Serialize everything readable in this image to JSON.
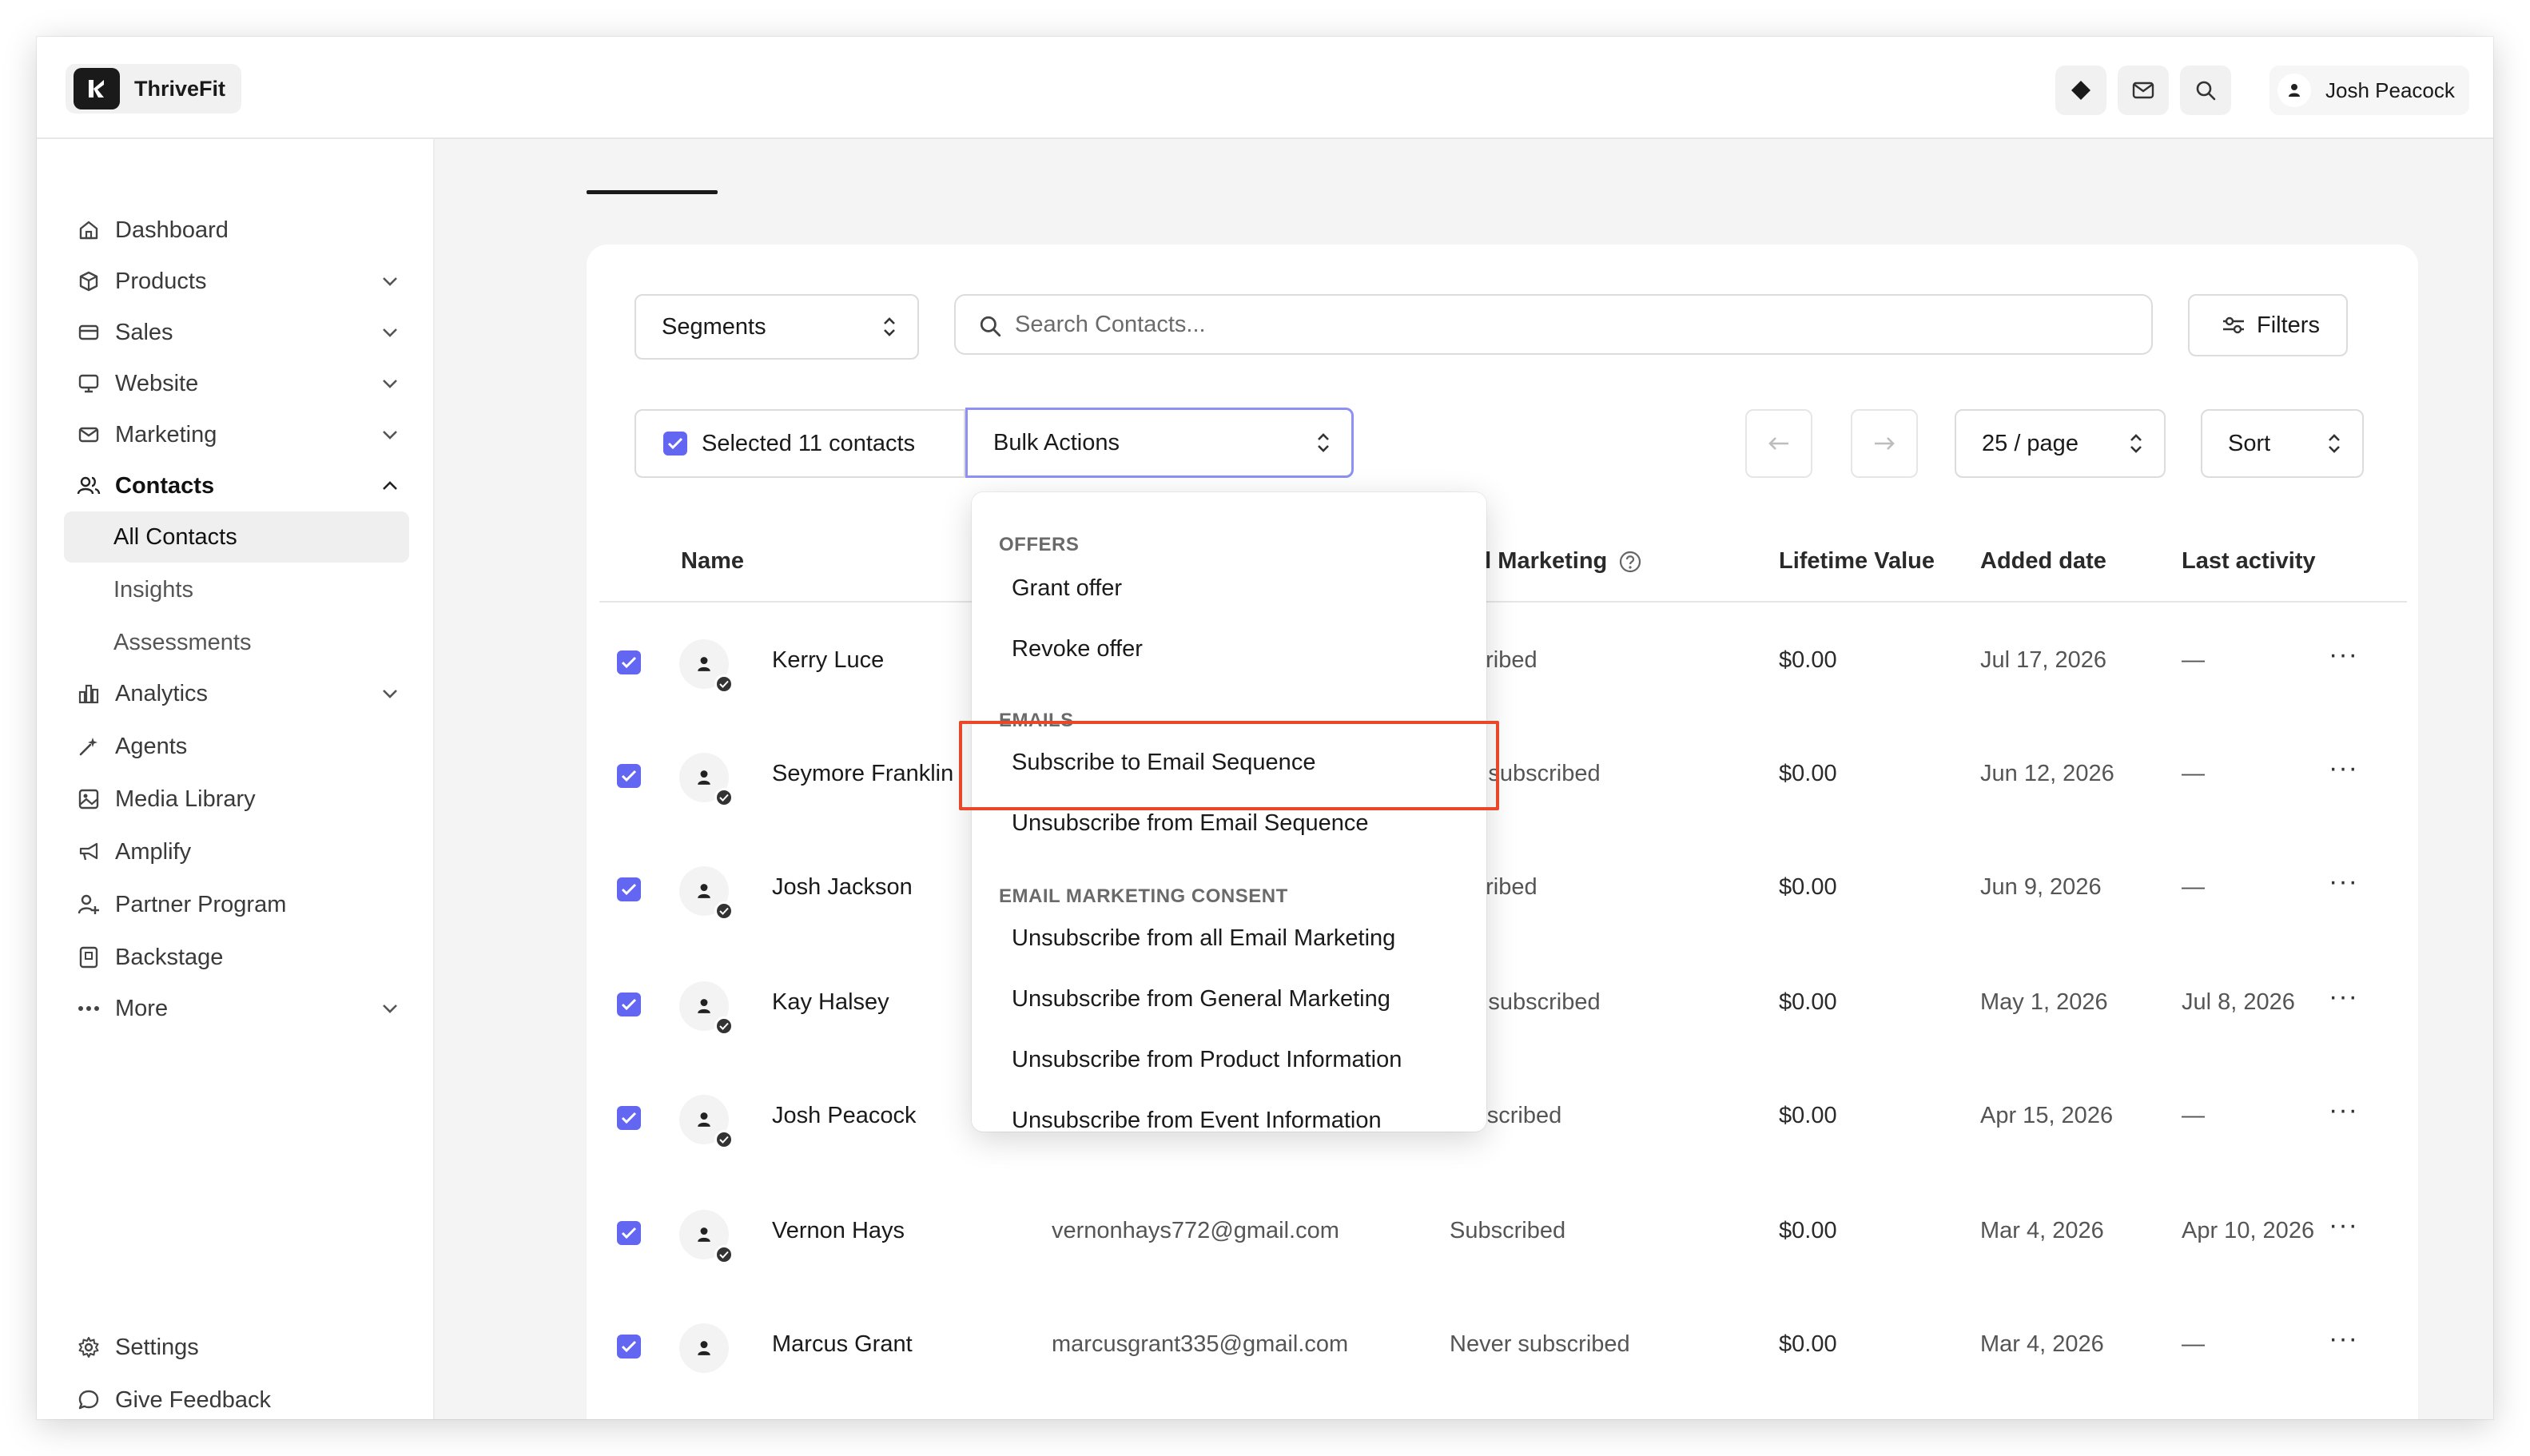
{
  "app": {
    "name": "ThriveFit"
  },
  "topbar": {
    "icons": [
      "diamond-icon",
      "mail-icon",
      "search-icon"
    ],
    "user_name": "Josh Peacock"
  },
  "sidebar": {
    "items": [
      {
        "label": "Dashboard",
        "icon": "home-icon"
      },
      {
        "label": "Products",
        "icon": "box-icon",
        "chevron": "down"
      },
      {
        "label": "Sales",
        "icon": "card-icon",
        "chevron": "down"
      },
      {
        "label": "Website",
        "icon": "monitor-icon",
        "chevron": "down"
      },
      {
        "label": "Marketing",
        "icon": "mail-icon",
        "chevron": "down"
      },
      {
        "label": "Contacts",
        "icon": "users-icon",
        "chevron": "up"
      },
      {
        "label": "All Contacts"
      },
      {
        "label": "Insights"
      },
      {
        "label": "Assessments"
      },
      {
        "label": "Analytics",
        "icon": "chart-icon",
        "chevron": "down"
      },
      {
        "label": "Agents",
        "icon": "sparkle-icon"
      },
      {
        "label": "Media Library",
        "icon": "image-icon"
      },
      {
        "label": "Amplify",
        "icon": "megaphone-icon"
      },
      {
        "label": "Partner Program",
        "icon": "partner-icon"
      },
      {
        "label": "Backstage",
        "icon": "badge-icon"
      },
      {
        "label": "More",
        "icon": "ellipsis-icon",
        "chevron": "down"
      }
    ],
    "footer": [
      {
        "label": "Settings",
        "icon": "gear-icon"
      },
      {
        "label": "Give Feedback",
        "icon": "chat-icon"
      }
    ]
  },
  "toolbar": {
    "segments_label": "Segments",
    "search_placeholder": "Search Contacts...",
    "filters_label": "Filters",
    "selected_label": "Selected 11 contacts",
    "bulk_actions_label": "Bulk Actions",
    "per_page_label": "25 / page",
    "sort_label": "Sort"
  },
  "table": {
    "headers": [
      "Name",
      "ail Marketing",
      "Lifetime Value",
      "Added date",
      "Last activity"
    ],
    "rows": [
      {
        "name": "Kerry Luce",
        "email": "",
        "status": "bscribed",
        "ltv": "$0.00",
        "added": "Jul 17, 2026",
        "last": "—"
      },
      {
        "name": "Seymore Franklin",
        "email": "",
        "status": "ver subscribed",
        "ltv": "$0.00",
        "added": "Jun 12, 2026",
        "last": "—"
      },
      {
        "name": "Josh Jackson",
        "email": "",
        "status": "bscribed",
        "ltv": "$0.00",
        "added": "Jun 9, 2026",
        "last": "—"
      },
      {
        "name": "Kay Halsey",
        "email": "",
        "status": "ver subscribed",
        "ltv": "$0.00",
        "added": "May 1, 2026",
        "last": "Jul 8, 2026"
      },
      {
        "name": "Josh Peacock",
        "email": "",
        "status": "subscribed",
        "ltv": "$0.00",
        "added": "Apr 15, 2026",
        "last": "—"
      },
      {
        "name": "Vernon Hays",
        "email": "vernonhays772@gmail.com",
        "status": "Subscribed",
        "ltv": "$0.00",
        "added": "Mar 4, 2026",
        "last": "Apr 10, 2026"
      },
      {
        "name": "Marcus Grant",
        "email": "marcusgrant335@gmail.com",
        "status": "Never subscribed",
        "ltv": "$0.00",
        "added": "Mar 4, 2026",
        "last": "—"
      }
    ]
  },
  "dropdown": {
    "groups": [
      {
        "title": "OFFERS",
        "items": [
          "Grant offer",
          "Revoke offer"
        ]
      },
      {
        "title": "EMAILS",
        "items": [
          "Subscribe to Email Sequence",
          "Unsubscribe from Email Sequence"
        ]
      },
      {
        "title": "EMAIL MARKETING CONSENT",
        "items": [
          "Unsubscribe from all Email Marketing",
          "Unsubscribe from General Marketing",
          "Unsubscribe from Product Information",
          "Unsubscribe from Event Information"
        ]
      }
    ]
  },
  "colors": {
    "accent": "#6366f1",
    "highlight": "#e9472a"
  }
}
